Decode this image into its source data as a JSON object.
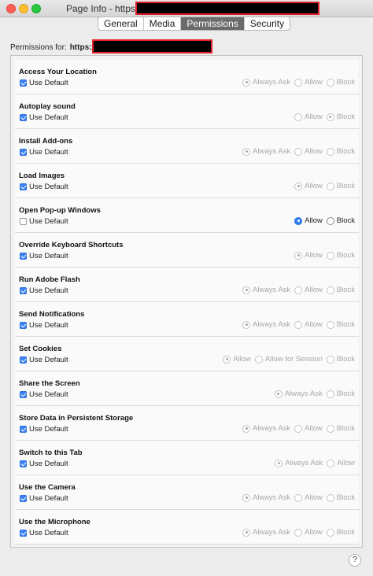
{
  "window": {
    "title_prefix": "Page Info - https://"
  },
  "tabs": [
    {
      "label": "General",
      "active": false
    },
    {
      "label": "Media",
      "active": false
    },
    {
      "label": "Permissions",
      "active": true
    },
    {
      "label": "Security",
      "active": false
    }
  ],
  "permissions_for": {
    "label": "Permissions for:",
    "url_prefix": "https://"
  },
  "help_label": "?",
  "permissions": [
    {
      "title": "Access Your Location",
      "use_default_label": "Use Default",
      "use_default": true,
      "options": [
        {
          "label": "Always Ask",
          "selected": true
        },
        {
          "label": "Allow",
          "selected": false
        },
        {
          "label": "Block",
          "selected": false
        }
      ]
    },
    {
      "title": "Autoplay sound",
      "use_default_label": "Use Default",
      "use_default": true,
      "options": [
        {
          "label": "Allow",
          "selected": false
        },
        {
          "label": "Block",
          "selected": true
        }
      ]
    },
    {
      "title": "Install Add-ons",
      "use_default_label": "Use Default",
      "use_default": true,
      "options": [
        {
          "label": "Always Ask",
          "selected": true
        },
        {
          "label": "Allow",
          "selected": false
        },
        {
          "label": "Block",
          "selected": false
        }
      ]
    },
    {
      "title": "Load Images",
      "use_default_label": "Use Default",
      "use_default": true,
      "options": [
        {
          "label": "Allow",
          "selected": true
        },
        {
          "label": "Block",
          "selected": false
        }
      ]
    },
    {
      "title": "Open Pop-up Windows",
      "use_default_label": "Use Default",
      "use_default": false,
      "options": [
        {
          "label": "Allow",
          "selected": true
        },
        {
          "label": "Block",
          "selected": false
        }
      ]
    },
    {
      "title": "Override Keyboard Shortcuts",
      "use_default_label": "Use Default",
      "use_default": true,
      "options": [
        {
          "label": "Allow",
          "selected": true
        },
        {
          "label": "Block",
          "selected": false
        }
      ]
    },
    {
      "title": "Run Adobe Flash",
      "use_default_label": "Use Default",
      "use_default": true,
      "options": [
        {
          "label": "Always Ask",
          "selected": true
        },
        {
          "label": "Allow",
          "selected": false
        },
        {
          "label": "Block",
          "selected": false
        }
      ]
    },
    {
      "title": "Send Notifications",
      "use_default_label": "Use Default",
      "use_default": true,
      "options": [
        {
          "label": "Always Ask",
          "selected": true
        },
        {
          "label": "Allow",
          "selected": false
        },
        {
          "label": "Block",
          "selected": false
        }
      ]
    },
    {
      "title": "Set Cookies",
      "use_default_label": "Use Default",
      "use_default": true,
      "options": [
        {
          "label": "Allow",
          "selected": true
        },
        {
          "label": "Allow for Session",
          "selected": false
        },
        {
          "label": "Block",
          "selected": false
        }
      ]
    },
    {
      "title": "Share the Screen",
      "use_default_label": "Use Default",
      "use_default": true,
      "options": [
        {
          "label": "Always Ask",
          "selected": true
        },
        {
          "label": "Block",
          "selected": false
        }
      ]
    },
    {
      "title": "Store Data in Persistent Storage",
      "use_default_label": "Use Default",
      "use_default": true,
      "options": [
        {
          "label": "Always Ask",
          "selected": true
        },
        {
          "label": "Allow",
          "selected": false
        },
        {
          "label": "Block",
          "selected": false
        }
      ]
    },
    {
      "title": "Switch to this Tab",
      "use_default_label": "Use Default",
      "use_default": true,
      "options": [
        {
          "label": "Always Ask",
          "selected": true
        },
        {
          "label": "Allow",
          "selected": false
        }
      ]
    },
    {
      "title": "Use the Camera",
      "use_default_label": "Use Default",
      "use_default": true,
      "options": [
        {
          "label": "Always Ask",
          "selected": true
        },
        {
          "label": "Allow",
          "selected": false
        },
        {
          "label": "Block",
          "selected": false
        }
      ]
    },
    {
      "title": "Use the Microphone",
      "use_default_label": "Use Default",
      "use_default": true,
      "options": [
        {
          "label": "Always Ask",
          "selected": true
        },
        {
          "label": "Allow",
          "selected": false
        },
        {
          "label": "Block",
          "selected": false
        }
      ]
    }
  ]
}
